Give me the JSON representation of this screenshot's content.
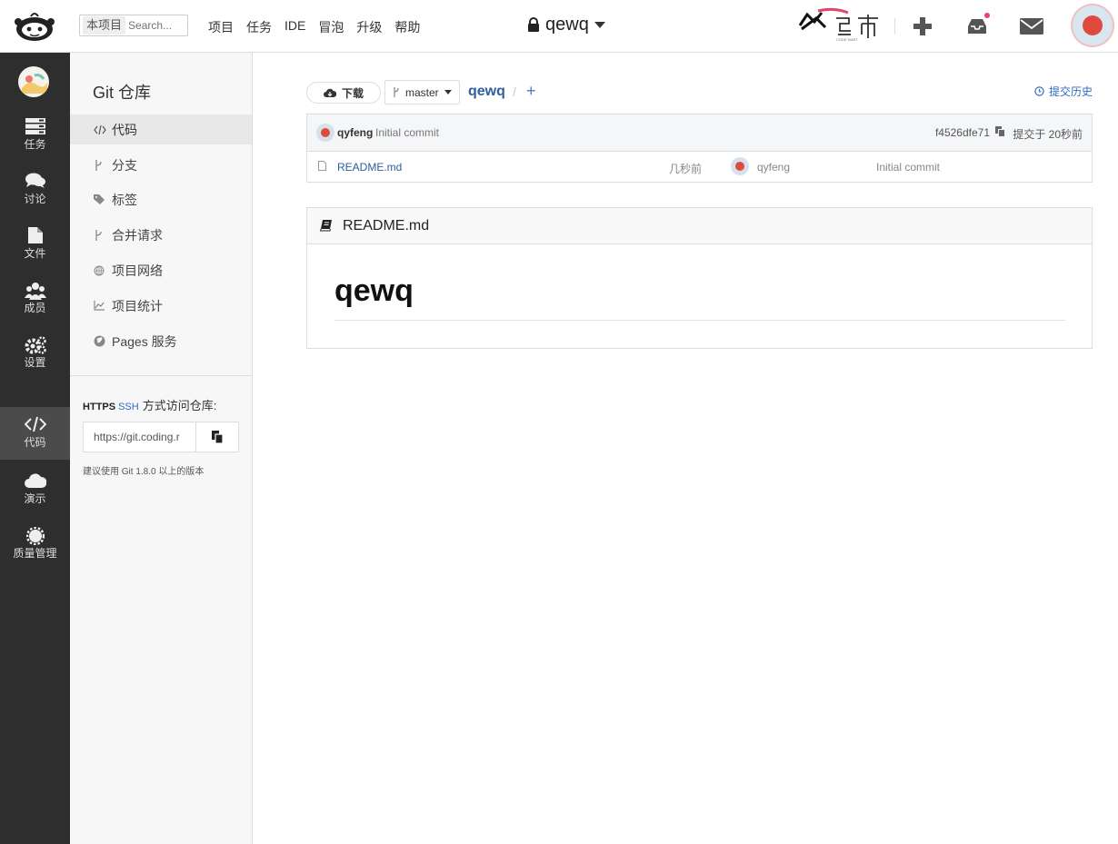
{
  "header": {
    "search_scope": "本项目",
    "search_placeholder": "Search...",
    "nav": [
      "项目",
      "任务",
      "IDE",
      "冒泡",
      "升级",
      "帮助"
    ],
    "project_name": "qewq"
  },
  "leftbar": {
    "items": [
      {
        "label": "任务",
        "icon": "tasks-icon"
      },
      {
        "label": "讨论",
        "icon": "comments-icon"
      },
      {
        "label": "文件",
        "icon": "file-icon"
      },
      {
        "label": "成员",
        "icon": "users-icon"
      },
      {
        "label": "设置",
        "icon": "gears-icon"
      },
      {
        "label": "代码",
        "icon": "code-icon",
        "active": true
      },
      {
        "label": "演示",
        "icon": "cloud-icon"
      },
      {
        "label": "质量管理",
        "icon": "badge-icon"
      }
    ]
  },
  "subbar": {
    "title": "Git 仓库",
    "items": [
      {
        "label": "代码",
        "icon": "code-icon",
        "active": true
      },
      {
        "label": "分支",
        "icon": "branch-icon"
      },
      {
        "label": "标签",
        "icon": "tags-icon"
      },
      {
        "label": "合并请求",
        "icon": "merge-icon"
      },
      {
        "label": "项目网络",
        "icon": "network-icon"
      },
      {
        "label": "项目统计",
        "icon": "chart-icon"
      },
      {
        "label": "Pages 服务",
        "icon": "globe-icon"
      }
    ],
    "access_https": "HTTPS",
    "access_ssh": "SSH",
    "access_text": "方式访问仓库:",
    "clone_url": "https://git.coding.r",
    "git_hint": "建议使用 Git 1.8.0 以上的版本"
  },
  "toolbar": {
    "download_label": "下载",
    "branch": "master",
    "repo": "qewq",
    "separator": "/",
    "add": "+",
    "history": "提交历史"
  },
  "commit": {
    "user": "qyfeng",
    "message": "Initial commit",
    "sha": "f4526dfe71",
    "time": "提交于 20秒前"
  },
  "files": [
    {
      "name": "README.md",
      "time": "几秒前",
      "user": "qyfeng",
      "message": "Initial commit"
    }
  ],
  "readme": {
    "title": "README.md",
    "heading": "qewq"
  },
  "colors": {
    "link": "#2f5e9e",
    "sidebar_bg": "#2e2e2e",
    "avatar_red": "#e04a3e"
  }
}
